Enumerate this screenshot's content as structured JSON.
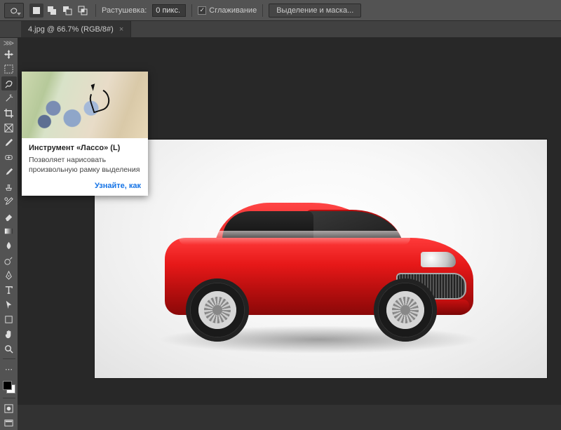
{
  "optionBar": {
    "feather_label": "Растушевка:",
    "feather_value": "0 пикс.",
    "antialias_label": "Сглаживание",
    "select_mask_button": "Выделение и маска..."
  },
  "document": {
    "tab_title": "4.jpg @ 66.7% (RGB/8#)"
  },
  "tooltip": {
    "title": "Инструмент «Лассо» (L)",
    "description": "Позволяет нарисовать произвольную рамку выделения",
    "link": "Узнайте, как"
  },
  "tools": [
    "move",
    "marquee",
    "lasso",
    "magic-wand",
    "crop",
    "frame",
    "eyedropper",
    "healing",
    "brush",
    "clone",
    "history-brush",
    "eraser",
    "gradient",
    "blur",
    "dodge",
    "pen",
    "type",
    "path-select",
    "rectangle",
    "hand",
    "zoom"
  ],
  "modeButtons": [
    "selection-new",
    "selection-add",
    "selection-subtract",
    "selection-intersect"
  ]
}
